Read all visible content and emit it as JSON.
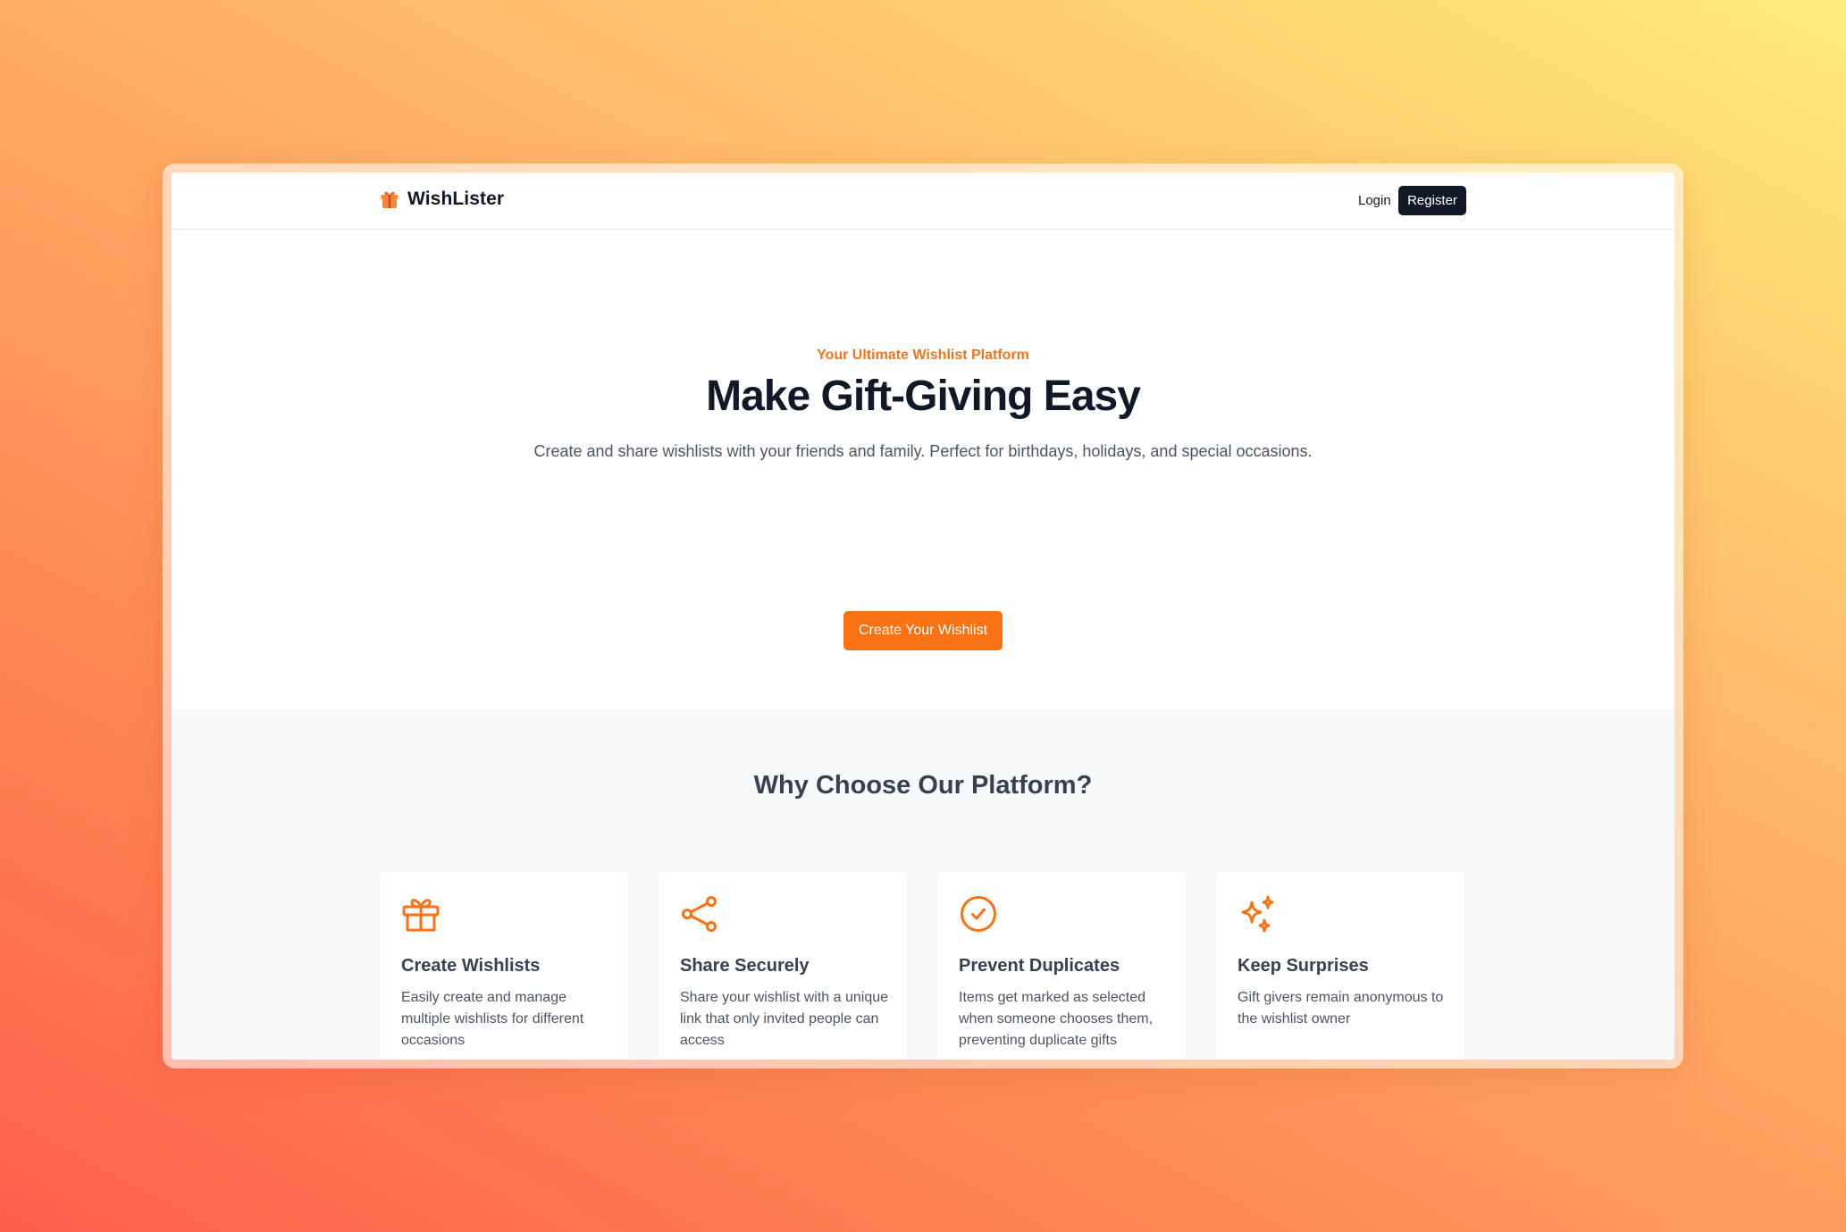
{
  "brand": {
    "name": "WishLister",
    "icon": "gift-icon"
  },
  "nav": {
    "login_label": "Login",
    "register_label": "Register"
  },
  "hero": {
    "eyebrow": "Your Ultimate Wishlist Platform",
    "title": "Make Gift-Giving Easy",
    "subtitle": "Create and share wishlists with your friends and family. Perfect for birthdays, holidays, and special occasions.",
    "cta_label": "Create Your Wishlist"
  },
  "features": {
    "title": "Why Choose Our Platform?",
    "items": [
      {
        "icon": "gift-icon",
        "title": "Create Wishlists",
        "description": "Easily create and manage multiple wishlists for different occasions"
      },
      {
        "icon": "share-icon",
        "title": "Share Securely",
        "description": "Share your wishlist with a unique link that only invited people can access"
      },
      {
        "icon": "check-circle-icon",
        "title": "Prevent Duplicates",
        "description": "Items get marked as selected when someone chooses them, preventing duplicate gifts"
      },
      {
        "icon": "sparkles-icon",
        "title": "Keep Surprises",
        "description": "Gift givers remain anonymous to the wishlist owner"
      }
    ]
  },
  "colors": {
    "accent": "#f97316",
    "dark": "#111827",
    "muted_text": "#4b5563",
    "section_bg": "#f8f9fb"
  }
}
